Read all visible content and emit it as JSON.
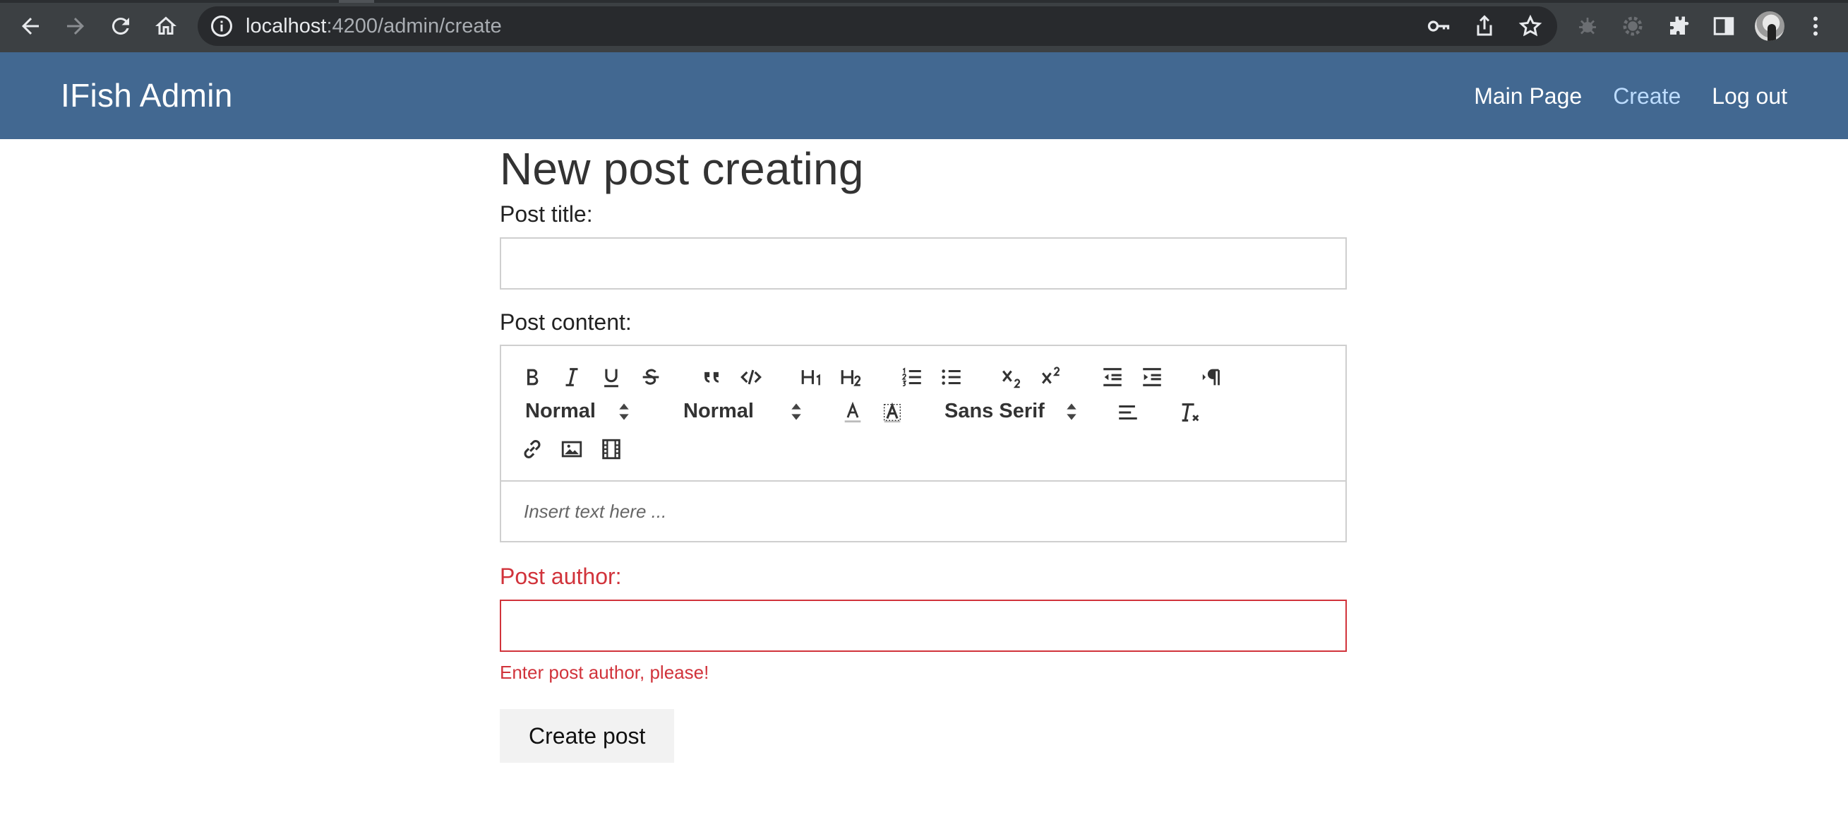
{
  "browser": {
    "url_host": "localhost",
    "url_path": ":4200/admin/create"
  },
  "navbar": {
    "brand": "IFish Admin",
    "links": [
      {
        "label": "Main Page",
        "active": false
      },
      {
        "label": "Create",
        "active": true
      },
      {
        "label": "Log out",
        "active": false
      }
    ]
  },
  "form": {
    "heading": "New post creating",
    "title_label": "Post title:",
    "title_value": "",
    "content_label": "Post content:",
    "editor": {
      "header_picker": "Normal",
      "size_picker": "Normal",
      "font_picker": "Sans Serif",
      "placeholder": "Insert text here ..."
    },
    "author_label": "Post author:",
    "author_value": "",
    "author_error": "Enter post author, please!",
    "submit_label": "Create post"
  },
  "colors": {
    "navbar": "#426891",
    "active_link": "#bcdcff",
    "error": "#d1333b",
    "chrome": "#3c4043"
  }
}
